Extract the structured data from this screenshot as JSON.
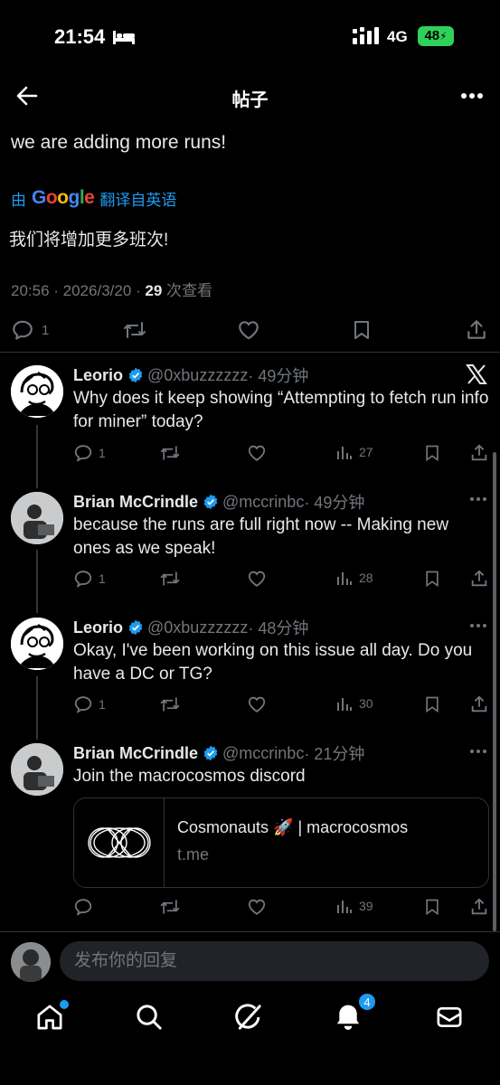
{
  "status_bar": {
    "time": "21:54",
    "network": "4G",
    "battery": "48"
  },
  "header": {
    "title": "帖子"
  },
  "post": {
    "text": "we are adding more runs!",
    "translate_prefix": "由",
    "translate_brand": "Google",
    "translate_suffix": "翻译自英语",
    "translated_text": "我们将增加更多班次!",
    "timestamp": "20:56 · 2026/3/20 · ",
    "views_count": "29",
    "views_label": " 次查看",
    "reply_count": "1"
  },
  "replies": [
    {
      "name": "Leorio",
      "handle": "@0xbuzzzzzz",
      "time": "· 49分钟",
      "text": "Why does it keep showing “Attempting to fetch run info for miner” today?",
      "reply_count": "1",
      "retweet_count": "",
      "like_count": "",
      "view_count": "27"
    },
    {
      "name": "Brian McCrindle",
      "handle": "@mccrinbc",
      "time": "· 49分钟",
      "text": "because the runs are full right now -- Making new ones as we speak!",
      "reply_count": "1",
      "retweet_count": "",
      "like_count": "",
      "view_count": "28"
    },
    {
      "name": "Leorio",
      "handle": "@0xbuzzzzzz",
      "time": "· 48分钟",
      "text": "Okay, I've been working on this issue all day. Do you have a DC or TG?",
      "reply_count": "1",
      "retweet_count": "",
      "like_count": "",
      "view_count": "30"
    },
    {
      "name": "Brian McCrindle",
      "handle": "@mccrinbc",
      "time": "· 21分钟",
      "text": "Join the macrocosmos discord",
      "reply_count": "",
      "retweet_count": "",
      "like_count": "",
      "view_count": "39",
      "card": {
        "title": "Cosmonauts 🚀 | macrocosmos",
        "domain": "t.me"
      }
    }
  ],
  "composer": {
    "placeholder": "发布你的回复"
  },
  "nav": {
    "notifications_badge": "4"
  },
  "colors": {
    "accent": "#1d9bf0",
    "muted": "#71767b",
    "background": "#000000",
    "battery": "#30d158"
  }
}
